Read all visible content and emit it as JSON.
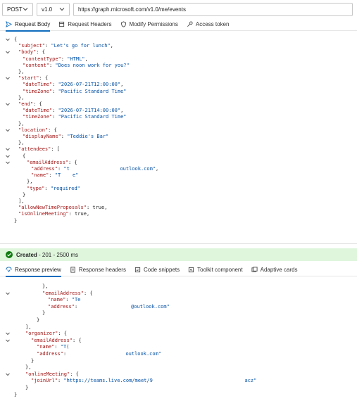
{
  "request": {
    "method": "POST",
    "version": "v1.0",
    "url": "https://graph.microsoft.com/v1.0/me/events",
    "tabs": [
      {
        "label": "Request Body",
        "icon": "send-icon"
      },
      {
        "label": "Request Headers",
        "icon": "headers-icon"
      },
      {
        "label": "Modify Permissions",
        "icon": "shield-icon"
      },
      {
        "label": "Access token",
        "icon": "key-icon"
      }
    ]
  },
  "request_body_lines": [
    {
      "indent": 0,
      "fold": true,
      "parts": [
        [
          "p",
          "{"
        ]
      ]
    },
    {
      "indent": 1,
      "fold": false,
      "parts": [
        [
          "k",
          "\"subject\""
        ],
        [
          "p",
          ": "
        ],
        [
          "s",
          "\"Let's go for lunch\""
        ],
        [
          "p",
          ","
        ]
      ]
    },
    {
      "indent": 1,
      "fold": true,
      "parts": [
        [
          "k",
          "\"body\""
        ],
        [
          "p",
          ": {"
        ]
      ]
    },
    {
      "indent": 2,
      "fold": false,
      "parts": [
        [
          "k",
          "\"contentType\""
        ],
        [
          "p",
          ": "
        ],
        [
          "s",
          "\"HTML\""
        ],
        [
          "p",
          ","
        ]
      ]
    },
    {
      "indent": 2,
      "fold": false,
      "parts": [
        [
          "k",
          "\"content\""
        ],
        [
          "p",
          ": "
        ],
        [
          "s",
          "\"Does noon work for you?\""
        ]
      ]
    },
    {
      "indent": 1,
      "fold": false,
      "parts": [
        [
          "p",
          "},"
        ]
      ]
    },
    {
      "indent": 1,
      "fold": true,
      "parts": [
        [
          "k",
          "\"start\""
        ],
        [
          "p",
          ": {"
        ]
      ]
    },
    {
      "indent": 2,
      "fold": false,
      "parts": [
        [
          "k",
          "\"dateTime\""
        ],
        [
          "p",
          ": "
        ],
        [
          "s",
          "\"2026-07-21T12:00:00\""
        ],
        [
          "p",
          ","
        ]
      ]
    },
    {
      "indent": 2,
      "fold": false,
      "parts": [
        [
          "k",
          "\"timeZone\""
        ],
        [
          "p",
          ": "
        ],
        [
          "s",
          "\"Pacific Standard Time\""
        ]
      ]
    },
    {
      "indent": 1,
      "fold": false,
      "parts": [
        [
          "p",
          "},"
        ]
      ]
    },
    {
      "indent": 1,
      "fold": true,
      "parts": [
        [
          "k",
          "\"end\""
        ],
        [
          "p",
          ": {"
        ]
      ]
    },
    {
      "indent": 2,
      "fold": false,
      "parts": [
        [
          "k",
          "\"dateTime\""
        ],
        [
          "p",
          ": "
        ],
        [
          "s",
          "\"2026-07-21T14:00:00\""
        ],
        [
          "p",
          ","
        ]
      ]
    },
    {
      "indent": 2,
      "fold": false,
      "parts": [
        [
          "k",
          "\"timeZone\""
        ],
        [
          "p",
          ": "
        ],
        [
          "s",
          "\"Pacific Standard Time\""
        ]
      ]
    },
    {
      "indent": 1,
      "fold": false,
      "parts": [
        [
          "p",
          "},"
        ]
      ]
    },
    {
      "indent": 1,
      "fold": true,
      "parts": [
        [
          "k",
          "\"location\""
        ],
        [
          "p",
          ": {"
        ]
      ]
    },
    {
      "indent": 2,
      "fold": false,
      "parts": [
        [
          "k",
          "\"displayName\""
        ],
        [
          "p",
          ": "
        ],
        [
          "s",
          "\"Teddie's Bar\""
        ]
      ]
    },
    {
      "indent": 1,
      "fold": false,
      "parts": [
        [
          "p",
          "},"
        ]
      ]
    },
    {
      "indent": 1,
      "fold": true,
      "parts": [
        [
          "k",
          "\"attendees\""
        ],
        [
          "p",
          ": ["
        ]
      ]
    },
    {
      "indent": 2,
      "fold": true,
      "parts": [
        [
          "p",
          "{"
        ]
      ]
    },
    {
      "indent": 3,
      "fold": true,
      "parts": [
        [
          "k",
          "\"emailAddress\""
        ],
        [
          "p",
          ": {"
        ]
      ]
    },
    {
      "indent": 4,
      "fold": false,
      "parts": [
        [
          "k",
          "\"address\""
        ],
        [
          "p",
          ": "
        ],
        [
          "s",
          "\"t                 outlook.com\""
        ],
        [
          "p",
          ","
        ]
      ]
    },
    {
      "indent": 4,
      "fold": false,
      "parts": [
        [
          "k",
          "\"name\""
        ],
        [
          "p",
          ": "
        ],
        [
          "s",
          "\"T    e\""
        ]
      ]
    },
    {
      "indent": 3,
      "fold": false,
      "parts": [
        [
          "p",
          "},"
        ]
      ]
    },
    {
      "indent": 3,
      "fold": false,
      "parts": [
        [
          "k",
          "\"type\""
        ],
        [
          "p",
          ": "
        ],
        [
          "s",
          "\"required\""
        ]
      ]
    },
    {
      "indent": 2,
      "fold": false,
      "parts": [
        [
          "p",
          "}"
        ]
      ]
    },
    {
      "indent": 1,
      "fold": false,
      "parts": [
        [
          "p",
          "],"
        ]
      ]
    },
    {
      "indent": 1,
      "fold": false,
      "parts": [
        [
          "k",
          "\"allowNewTimeProposals\""
        ],
        [
          "p",
          ": true,"
        ]
      ]
    },
    {
      "indent": 1,
      "fold": false,
      "parts": [
        [
          "k",
          "\"isOnlineMeeting\""
        ],
        [
          "p",
          ": true,"
        ]
      ]
    },
    {
      "indent": 0,
      "fold": false,
      "parts": [
        [
          "p",
          "}"
        ]
      ]
    }
  ],
  "status": {
    "label": "Created",
    "detail": " - 201 - 2500 ms"
  },
  "response": {
    "tabs": [
      {
        "label": "Response preview",
        "icon": "preview-icon"
      },
      {
        "label": "Response headers",
        "icon": "headers-icon"
      },
      {
        "label": "Code snippets",
        "icon": "code-icon"
      },
      {
        "label": "Toolkit component",
        "icon": "toolkit-icon"
      },
      {
        "label": "Adaptive cards",
        "icon": "cards-icon"
      }
    ]
  },
  "response_lines": [
    {
      "indent": 5,
      "fold": false,
      "parts": [
        [
          "p",
          "},"
        ]
      ]
    },
    {
      "indent": 5,
      "fold": true,
      "parts": [
        [
          "k",
          "\"emailAddress\""
        ],
        [
          "p",
          ": {"
        ]
      ]
    },
    {
      "indent": 6,
      "fold": false,
      "parts": [
        [
          "k",
          "\"name\""
        ],
        [
          "p",
          ": "
        ],
        [
          "s",
          "\"Te"
        ]
      ]
    },
    {
      "indent": 6,
      "fold": false,
      "parts": [
        [
          "k",
          "\"address\""
        ],
        [
          "p",
          ":                  "
        ],
        [
          "s",
          "@outlook.com\""
        ]
      ]
    },
    {
      "indent": 5,
      "fold": false,
      "parts": [
        [
          "p",
          "}"
        ]
      ]
    },
    {
      "indent": 4,
      "fold": false,
      "parts": [
        [
          "p",
          "}"
        ]
      ]
    },
    {
      "indent": 2,
      "fold": false,
      "parts": [
        [
          "p",
          "],"
        ]
      ]
    },
    {
      "indent": 2,
      "fold": true,
      "parts": [
        [
          "k",
          "\"organizer\""
        ],
        [
          "p",
          ": {"
        ]
      ]
    },
    {
      "indent": 3,
      "fold": true,
      "parts": [
        [
          "k",
          "\"emailAddress\""
        ],
        [
          "p",
          ": {"
        ]
      ]
    },
    {
      "indent": 4,
      "fold": false,
      "parts": [
        [
          "k",
          "\"name\""
        ],
        [
          "p",
          ": "
        ],
        [
          "s",
          "\"T("
        ]
      ]
    },
    {
      "indent": 4,
      "fold": false,
      "parts": [
        [
          "k",
          "\"address\""
        ],
        [
          "p",
          ":                    "
        ],
        [
          "s",
          "outlook.com\""
        ]
      ]
    },
    {
      "indent": 3,
      "fold": false,
      "parts": [
        [
          "p",
          "}"
        ]
      ]
    },
    {
      "indent": 2,
      "fold": false,
      "parts": [
        [
          "p",
          "},"
        ]
      ]
    },
    {
      "indent": 2,
      "fold": true,
      "parts": [
        [
          "k",
          "\"onlineMeeting\""
        ],
        [
          "p",
          ": {"
        ]
      ]
    },
    {
      "indent": 3,
      "fold": false,
      "parts": [
        [
          "k",
          "\"joinUrl\""
        ],
        [
          "p",
          ": "
        ],
        [
          "s",
          "\"https://teams.live.com/meet/9                               acz\""
        ]
      ]
    },
    {
      "indent": 2,
      "fold": false,
      "parts": [
        [
          "p",
          "}"
        ]
      ]
    },
    {
      "indent": 0,
      "fold": false,
      "parts": [
        [
          "p",
          "}"
        ]
      ]
    }
  ],
  "colors": {
    "accent": "#0f6cbd",
    "key": "#a31515",
    "string": "#0451a5",
    "success_bg": "#dff6dd",
    "success_icon": "#107c10"
  }
}
